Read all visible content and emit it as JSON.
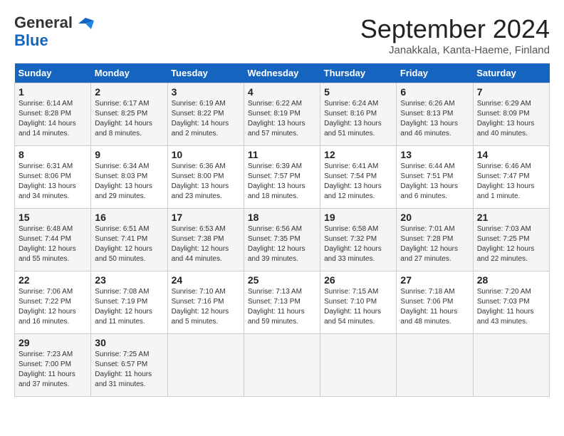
{
  "header": {
    "logo_line1": "General",
    "logo_line2": "Blue",
    "month": "September 2024",
    "location": "Janakkala, Kanta-Haeme, Finland"
  },
  "weekdays": [
    "Sunday",
    "Monday",
    "Tuesday",
    "Wednesday",
    "Thursday",
    "Friday",
    "Saturday"
  ],
  "weeks": [
    [
      {
        "day": "1",
        "sunrise": "6:14 AM",
        "sunset": "8:28 PM",
        "daylight": "14 hours and 14 minutes."
      },
      {
        "day": "2",
        "sunrise": "6:17 AM",
        "sunset": "8:25 PM",
        "daylight": "14 hours and 8 minutes."
      },
      {
        "day": "3",
        "sunrise": "6:19 AM",
        "sunset": "8:22 PM",
        "daylight": "14 hours and 2 minutes."
      },
      {
        "day": "4",
        "sunrise": "6:22 AM",
        "sunset": "8:19 PM",
        "daylight": "13 hours and 57 minutes."
      },
      {
        "day": "5",
        "sunrise": "6:24 AM",
        "sunset": "8:16 PM",
        "daylight": "13 hours and 51 minutes."
      },
      {
        "day": "6",
        "sunrise": "6:26 AM",
        "sunset": "8:13 PM",
        "daylight": "13 hours and 46 minutes."
      },
      {
        "day": "7",
        "sunrise": "6:29 AM",
        "sunset": "8:09 PM",
        "daylight": "13 hours and 40 minutes."
      }
    ],
    [
      {
        "day": "8",
        "sunrise": "6:31 AM",
        "sunset": "8:06 PM",
        "daylight": "13 hours and 34 minutes."
      },
      {
        "day": "9",
        "sunrise": "6:34 AM",
        "sunset": "8:03 PM",
        "daylight": "13 hours and 29 minutes."
      },
      {
        "day": "10",
        "sunrise": "6:36 AM",
        "sunset": "8:00 PM",
        "daylight": "13 hours and 23 minutes."
      },
      {
        "day": "11",
        "sunrise": "6:39 AM",
        "sunset": "7:57 PM",
        "daylight": "13 hours and 18 minutes."
      },
      {
        "day": "12",
        "sunrise": "6:41 AM",
        "sunset": "7:54 PM",
        "daylight": "13 hours and 12 minutes."
      },
      {
        "day": "13",
        "sunrise": "6:44 AM",
        "sunset": "7:51 PM",
        "daylight": "13 hours and 6 minutes."
      },
      {
        "day": "14",
        "sunrise": "6:46 AM",
        "sunset": "7:47 PM",
        "daylight": "13 hours and 1 minute."
      }
    ],
    [
      {
        "day": "15",
        "sunrise": "6:48 AM",
        "sunset": "7:44 PM",
        "daylight": "12 hours and 55 minutes."
      },
      {
        "day": "16",
        "sunrise": "6:51 AM",
        "sunset": "7:41 PM",
        "daylight": "12 hours and 50 minutes."
      },
      {
        "day": "17",
        "sunrise": "6:53 AM",
        "sunset": "7:38 PM",
        "daylight": "12 hours and 44 minutes."
      },
      {
        "day": "18",
        "sunrise": "6:56 AM",
        "sunset": "7:35 PM",
        "daylight": "12 hours and 39 minutes."
      },
      {
        "day": "19",
        "sunrise": "6:58 AM",
        "sunset": "7:32 PM",
        "daylight": "12 hours and 33 minutes."
      },
      {
        "day": "20",
        "sunrise": "7:01 AM",
        "sunset": "7:28 PM",
        "daylight": "12 hours and 27 minutes."
      },
      {
        "day": "21",
        "sunrise": "7:03 AM",
        "sunset": "7:25 PM",
        "daylight": "12 hours and 22 minutes."
      }
    ],
    [
      {
        "day": "22",
        "sunrise": "7:06 AM",
        "sunset": "7:22 PM",
        "daylight": "12 hours and 16 minutes."
      },
      {
        "day": "23",
        "sunrise": "7:08 AM",
        "sunset": "7:19 PM",
        "daylight": "12 hours and 11 minutes."
      },
      {
        "day": "24",
        "sunrise": "7:10 AM",
        "sunset": "7:16 PM",
        "daylight": "12 hours and 5 minutes."
      },
      {
        "day": "25",
        "sunrise": "7:13 AM",
        "sunset": "7:13 PM",
        "daylight": "11 hours and 59 minutes."
      },
      {
        "day": "26",
        "sunrise": "7:15 AM",
        "sunset": "7:10 PM",
        "daylight": "11 hours and 54 minutes."
      },
      {
        "day": "27",
        "sunrise": "7:18 AM",
        "sunset": "7:06 PM",
        "daylight": "11 hours and 48 minutes."
      },
      {
        "day": "28",
        "sunrise": "7:20 AM",
        "sunset": "7:03 PM",
        "daylight": "11 hours and 43 minutes."
      }
    ],
    [
      {
        "day": "29",
        "sunrise": "7:23 AM",
        "sunset": "7:00 PM",
        "daylight": "11 hours and 37 minutes."
      },
      {
        "day": "30",
        "sunrise": "7:25 AM",
        "sunset": "6:57 PM",
        "daylight": "11 hours and 31 minutes."
      },
      {
        "day": "",
        "sunrise": "",
        "sunset": "",
        "daylight": ""
      },
      {
        "day": "",
        "sunrise": "",
        "sunset": "",
        "daylight": ""
      },
      {
        "day": "",
        "sunrise": "",
        "sunset": "",
        "daylight": ""
      },
      {
        "day": "",
        "sunrise": "",
        "sunset": "",
        "daylight": ""
      },
      {
        "day": "",
        "sunrise": "",
        "sunset": "",
        "daylight": ""
      }
    ]
  ]
}
